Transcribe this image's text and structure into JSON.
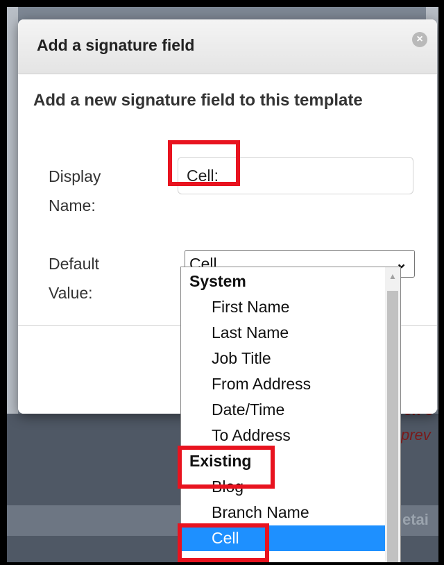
{
  "dialog": {
    "title": "Add a signature field",
    "close_icon": "close-circle-icon",
    "subtitle": "Add a new signature field to this template",
    "display_name_label_1": "Display",
    "display_name_label_2": "Name:",
    "display_name_value": "Cell:",
    "default_value_label_1": "Default",
    "default_value_label_2": "Value:",
    "default_value_selected": "Cell"
  },
  "dropdown": {
    "groups": [
      {
        "label": "System",
        "options": [
          "First Name",
          "Last Name",
          "Job Title",
          "From Address",
          "Date/Time",
          "To Address"
        ]
      },
      {
        "label": "Existing",
        "options": [
          "Blog",
          "Branch Name",
          "Cell"
        ]
      }
    ],
    "selected": "Cell"
  },
  "background": {
    "partial_text_1": "ck c",
    "partial_text_2": "prev",
    "partial_text_3": "etai"
  },
  "colors": {
    "highlight": "#e8131f",
    "selected_option": "#1e90ff"
  }
}
